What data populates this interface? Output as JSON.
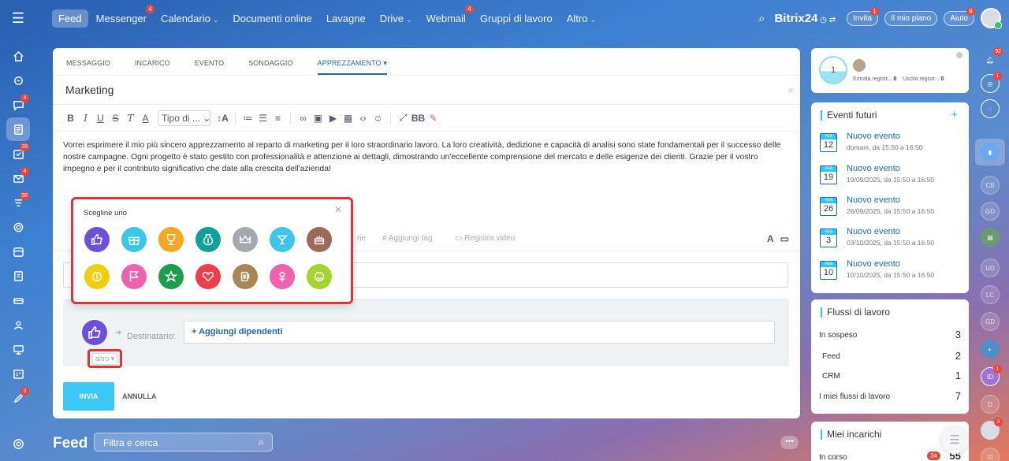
{
  "topbar": {
    "nav": [
      {
        "label": "Feed",
        "active": true
      },
      {
        "label": "Messenger",
        "badge": "4"
      },
      {
        "label": "Calendario",
        "dropdown": true
      },
      {
        "label": "Documenti online"
      },
      {
        "label": "Lavagne"
      },
      {
        "label": "Drive",
        "dropdown": true
      },
      {
        "label": "Webmail",
        "badge": "4"
      },
      {
        "label": "Gruppi di lavoro"
      },
      {
        "label": "Altro",
        "dropdown": true
      }
    ],
    "brand": "Bitrix",
    "brand_num": "24",
    "invite": "Invita",
    "invite_badge": "1",
    "plan": "Il mio piano",
    "help": "Aiuto",
    "help_badge": "9"
  },
  "left_sidebar_badges": {
    "b2": "4",
    "b4": "39",
    "b5": "4",
    "b6": "58",
    "b12": "3"
  },
  "editor": {
    "tabs": [
      "MESSAGGIO",
      "INCARICO",
      "EVENTO",
      "SONDAGGIO",
      "APPREZZAMENTO"
    ],
    "title": "Marketing",
    "font_select": "Tipo di ...",
    "body": "Vorrei esprimere il mio più sincero apprezzamento al reparto di marketing per il loro straordinario lavoro. La loro creatività, dedizione e capacità di analisi sono state fondamentali per il successo delle nostre campagne. Ogni progetto è stato gestito con professionalità e attenzione ai dettagli, dimostrando un'eccellente comprensione del mercato e delle esigenze dei clienti. Grazie per il vostro impegno e per il contributo significativo che date alla crescita dell'azienda!",
    "row2_ne": "ne",
    "add_tag": "Aggiungi tag",
    "record_video": "Registra video",
    "recipient_label": "Destinatario:",
    "add_employees": "+ Aggiungi dipendenti",
    "altro": "altro",
    "send": "INVIA",
    "cancel": "ANNULLA"
  },
  "popup": {
    "title": "Scegline uno",
    "icons": [
      {
        "name": "thumbs-up",
        "color": "#6c51d8"
      },
      {
        "name": "gift",
        "color": "#3cc7e8"
      },
      {
        "name": "trophy",
        "color": "#f5a623"
      },
      {
        "name": "money",
        "color": "#13a098"
      },
      {
        "name": "crown",
        "color": "#a4a9b0"
      },
      {
        "name": "cocktail",
        "color": "#3cc7e8"
      },
      {
        "name": "cake",
        "color": "#9a6b5a"
      },
      {
        "name": "coin",
        "color": "#f6cd0d"
      },
      {
        "name": "flag",
        "color": "#f062ad"
      },
      {
        "name": "star",
        "color": "#1e9d4b"
      },
      {
        "name": "heart",
        "color": "#ef3e4a"
      },
      {
        "name": "beer",
        "color": "#a78753"
      },
      {
        "name": "flower",
        "color": "#f062ad"
      },
      {
        "name": "smile",
        "color": "#a5d42f"
      }
    ]
  },
  "feed": {
    "title": "Feed",
    "search_placeholder": "Filtra e cerca"
  },
  "timeman": {
    "count": "1",
    "in_label": "Entrata registr...",
    "in_val": "0",
    "out_label": "Uscita registr...",
    "out_val": "0"
  },
  "events": {
    "title": "Eventi futuri",
    "items": [
      {
        "month": "VEN",
        "day": "12",
        "title": "Nuovo evento",
        "sub": "domani, da 15:50 a 16:50"
      },
      {
        "month": "VEN",
        "day": "19",
        "title": "Nuovo evento",
        "sub": "19/09/2025, da 15:50 a 16:50"
      },
      {
        "month": "VEN",
        "day": "26",
        "title": "Nuovo evento",
        "sub": "26/09/2025, da 15:50 a 16:50"
      },
      {
        "month": "VEN",
        "day": "3",
        "title": "Nuovo evento",
        "sub": "03/10/2025, da 15:50 a 16:50"
      },
      {
        "month": "VEN",
        "day": "10",
        "title": "Nuovo evento",
        "sub": "10/10/2025, da 15:50 a 16:50"
      }
    ]
  },
  "flows": {
    "title": "Flussi di lavoro",
    "items": [
      {
        "label": "In sospeso",
        "value": "3"
      },
      {
        "label": "Feed",
        "value": "2"
      },
      {
        "label": "CRM",
        "value": "1"
      },
      {
        "label": "I miei flussi di lavoro",
        "value": "7"
      }
    ]
  },
  "tasks": {
    "title": "Miei incarichi",
    "in_progress": "In corso",
    "badge": "34",
    "value": "55"
  },
  "right_sidebar": {
    "notif_badge": "92",
    "b2_badge": "1",
    "avatars": [
      "CB",
      "GD",
      "UD",
      "LC",
      "GD",
      "D"
    ],
    "id_avatar": "ID",
    "id_badge": "1",
    "bottom_badge": "3"
  }
}
